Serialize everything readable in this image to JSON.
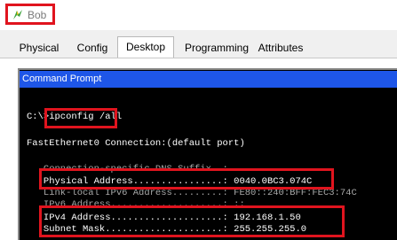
{
  "window": {
    "title": "Bob"
  },
  "tabs": [
    {
      "label": "Physical",
      "active": false
    },
    {
      "label": "Config",
      "active": false
    },
    {
      "label": "Desktop",
      "active": true
    },
    {
      "label": "Programming",
      "active": false
    },
    {
      "label": "Attributes",
      "active": false
    }
  ],
  "command_prompt": {
    "title": "Command Prompt",
    "lines": [
      "C:\\>ipconfig /all",
      "FastEthernet0 Connection:(default port)",
      "   Connection-specific DNS Suffix..:",
      "   Physical Address................: 0040.0BC3.074C",
      "   Link-local IPv6 Address.........: FE80::240:BFF:FEC3:74C",
      "   IPv6 Address....................: ::",
      "   IPv4 Address....................: 192.168.1.50",
      "   Subnet Mask.....................: 255.255.255.0"
    ]
  },
  "colors": {
    "highlight": "#e0141e",
    "cmd_titlebar": "#1e56e8",
    "terminal_bg": "#000000"
  }
}
